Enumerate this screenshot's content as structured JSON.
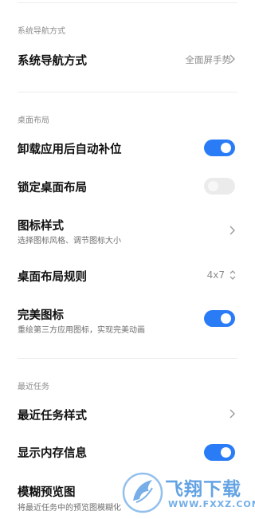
{
  "sections": {
    "navigation": {
      "header": "系统导航方式",
      "items": [
        {
          "title": "系统导航方式",
          "value": "全面屏手势"
        }
      ]
    },
    "desktop": {
      "header": "桌面布局",
      "items": [
        {
          "title": "卸载应用后自动补位",
          "toggle": "on"
        },
        {
          "title": "锁定桌面布局",
          "toggle": "off"
        },
        {
          "title": "图标样式",
          "subtitle": "选择图标风格、调节图标大小"
        },
        {
          "title": "桌面布局规则",
          "value": "4x7"
        },
        {
          "title": "完美图标",
          "subtitle": "重绘第三方应用图标，实现完美动画",
          "toggle": "on"
        }
      ]
    },
    "recents": {
      "header": "最近任务",
      "items": [
        {
          "title": "最近任务样式"
        },
        {
          "title": "显示内存信息",
          "toggle": "on"
        },
        {
          "title": "模糊预览图",
          "subtitle": "将最近任务中的预览图模糊化"
        }
      ]
    }
  },
  "watermark": {
    "brand": "飞翔下载",
    "url": "WWW.FXXZ.COM"
  },
  "colors": {
    "accent": "#2a7cf6",
    "toggle_off": "#ebebeb",
    "watermark_blue": "#3a8dde"
  }
}
